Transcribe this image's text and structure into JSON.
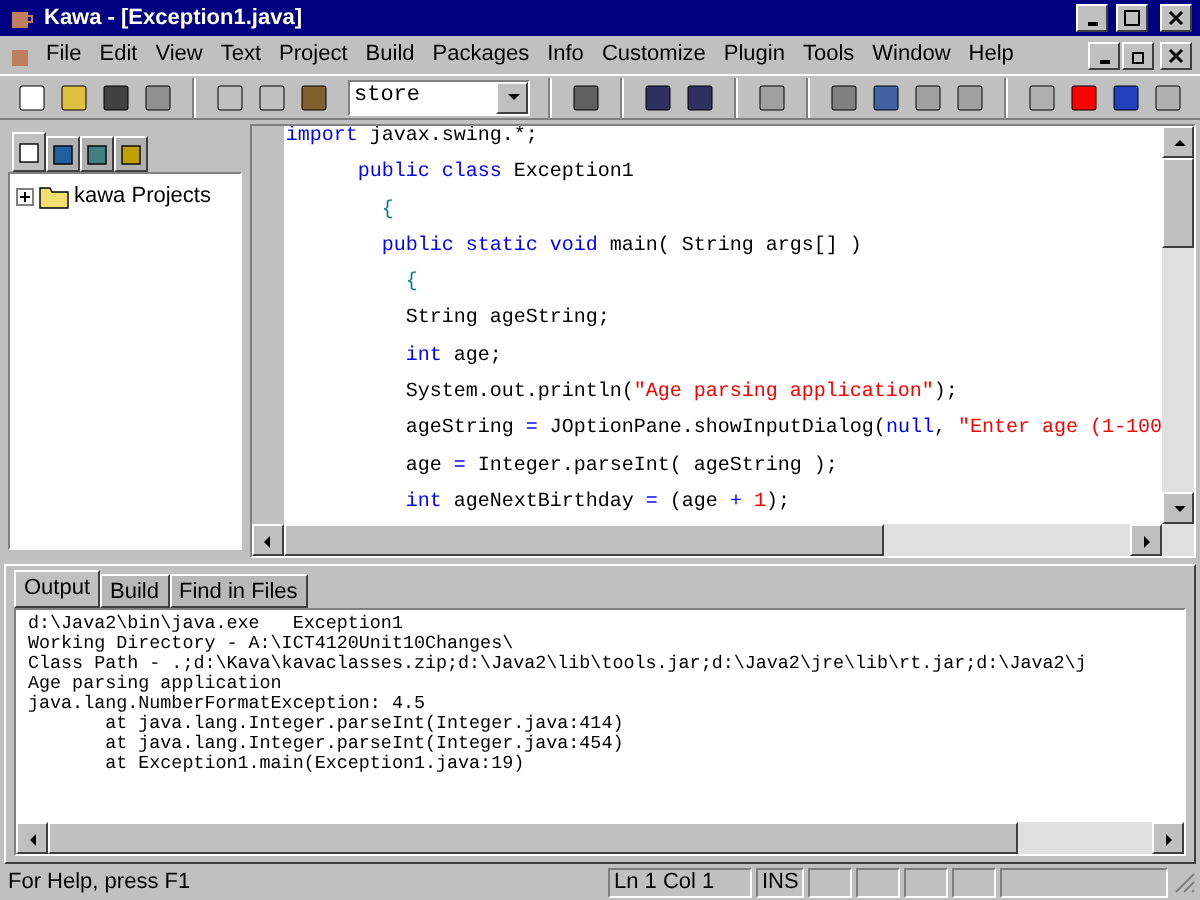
{
  "window": {
    "title": "Kawa - [Exception1.java]"
  },
  "menu": [
    "File",
    "Edit",
    "View",
    "Text",
    "Project",
    "Build",
    "Packages",
    "Info",
    "Customize",
    "Plugin",
    "Tools",
    "Window",
    "Help"
  ],
  "toolbar": {
    "combo_value": "store"
  },
  "sidebar": {
    "tabs": [
      {
        "selected": true
      },
      {
        "selected": false
      },
      {
        "selected": false
      },
      {
        "selected": false
      }
    ],
    "tree": [
      {
        "label": "kawa Projects",
        "expanded": false
      }
    ]
  },
  "editor": {
    "lines": [
      [
        {
          "kind": "keyword",
          "text": "import"
        },
        {
          "kind": "plain",
          "text": " javax.swing.*;"
        }
      ],
      [
        {
          "kind": "keyword",
          "text": "      public class"
        },
        {
          "kind": "plain",
          "text": " Exception1"
        }
      ],
      [
        {
          "kind": "brace",
          "text": "        {"
        }
      ],
      [
        {
          "kind": "keyword",
          "text": "        public static void"
        },
        {
          "kind": "plain",
          "text": " main( String args[] )"
        }
      ],
      [
        {
          "kind": "brace",
          "text": "          {"
        }
      ],
      [
        {
          "kind": "plain",
          "text": "          String ageString;"
        }
      ],
      [
        {
          "kind": "keyword",
          "text": "          int"
        },
        {
          "kind": "plain",
          "text": " age;"
        }
      ],
      [
        {
          "kind": "plain",
          "text": "          System.out.println("
        },
        {
          "kind": "string",
          "text": "\"Age parsing application\""
        },
        {
          "kind": "plain",
          "text": ");"
        }
      ],
      [
        {
          "kind": "plain",
          "text": "          ageString "
        },
        {
          "kind": "keyword",
          "text": "="
        },
        {
          "kind": "plain",
          "text": " JOptionPane.showInputDialog("
        },
        {
          "kind": "keyword",
          "text": "null"
        },
        {
          "kind": "plain",
          "text": ", "
        },
        {
          "kind": "string",
          "text": "\"Enter age (1-100"
        }
      ],
      [
        {
          "kind": "plain",
          "text": "          age "
        },
        {
          "kind": "keyword",
          "text": "="
        },
        {
          "kind": "plain",
          "text": " Integer.parseInt( ageString );"
        }
      ],
      [
        {
          "kind": "keyword",
          "text": "          int"
        },
        {
          "kind": "plain",
          "text": " ageNextBirthday "
        },
        {
          "kind": "keyword",
          "text": "="
        },
        {
          "kind": "plain",
          "text": " (age "
        },
        {
          "kind": "keyword",
          "text": "+ "
        },
        {
          "kind": "string",
          "text": "1"
        },
        {
          "kind": "plain",
          "text": ");"
        }
      ]
    ]
  },
  "output": {
    "tabs": [
      {
        "label": "Output",
        "selected": true
      },
      {
        "label": "Build",
        "selected": false
      },
      {
        "label": "Find in Files",
        "selected": false
      }
    ],
    "lines": [
      "d:\\Java2\\bin\\java.exe   Exception1",
      "Working Directory - A:\\ICT4120Unit10Changes\\",
      "Class Path - .;d:\\Kava\\kavaclasses.zip;d:\\Java2\\lib\\tools.jar;d:\\Java2\\jre\\lib\\rt.jar;d:\\Java2\\j",
      "Age parsing application",
      "java.lang.NumberFormatException: 4.5",
      "       at java.lang.Integer.parseInt(Integer.java:414)",
      "       at java.lang.Integer.parseInt(Integer.java:454)",
      "       at Exception1.main(Exception1.java:19)"
    ]
  },
  "status_bar": {
    "help": "For Help, press F1",
    "position": "Ln 1 Col 1",
    "mode": "INS"
  }
}
